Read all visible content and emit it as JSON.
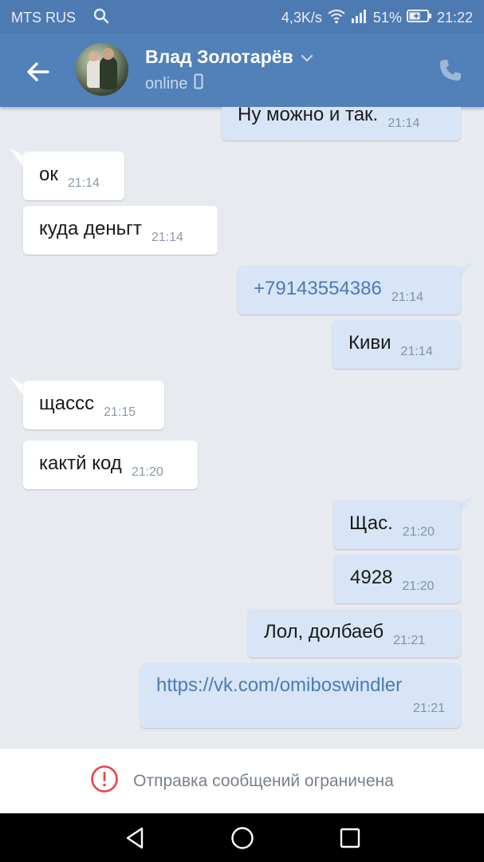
{
  "status_bar": {
    "carrier": "MTS RUS",
    "speed": "4,3K/s",
    "battery": "51%",
    "time": "21:22",
    "icons": [
      "search-icon",
      "wifi-icon",
      "signal-icon",
      "battery-icon"
    ]
  },
  "header": {
    "name": "Влад Золотарёв",
    "status": "online",
    "icons": [
      "back-arrow-icon",
      "chevron-down-icon",
      "mobile-icon",
      "phone-icon"
    ]
  },
  "messages": [
    {
      "dir": "out",
      "text": "Ну можно и так.",
      "time": "21:14"
    },
    {
      "dir": "in",
      "text": "ок",
      "time": "21:14"
    },
    {
      "dir": "in",
      "text": "куда деньгт",
      "time": "21:14"
    },
    {
      "dir": "out",
      "text": "+79143554386",
      "time": "21:14",
      "link": true
    },
    {
      "dir": "out",
      "text": "Киви",
      "time": "21:14"
    },
    {
      "dir": "in",
      "text": "щассс",
      "time": "21:15"
    },
    {
      "dir": "in",
      "text": "кактй код",
      "time": "21:20"
    },
    {
      "dir": "out",
      "text": "Щас.",
      "time": "21:20"
    },
    {
      "dir": "out",
      "text": "4928",
      "time": "21:20"
    },
    {
      "dir": "out",
      "text": "Лол, долбаеб",
      "time": "21:21"
    },
    {
      "dir": "out",
      "text": "https://vk.com/omiboswindler",
      "time": "21:21",
      "link": true
    }
  ],
  "restriction": {
    "text": "Отправка сообщений ограничена",
    "icon": "warning-circle-icon"
  },
  "colors": {
    "header": "#5181b8",
    "background": "#e7ebf0",
    "outgoing": "#d7e5f6",
    "incoming": "#ffffff",
    "link": "#4e7ab2",
    "warning": "#e64646"
  }
}
